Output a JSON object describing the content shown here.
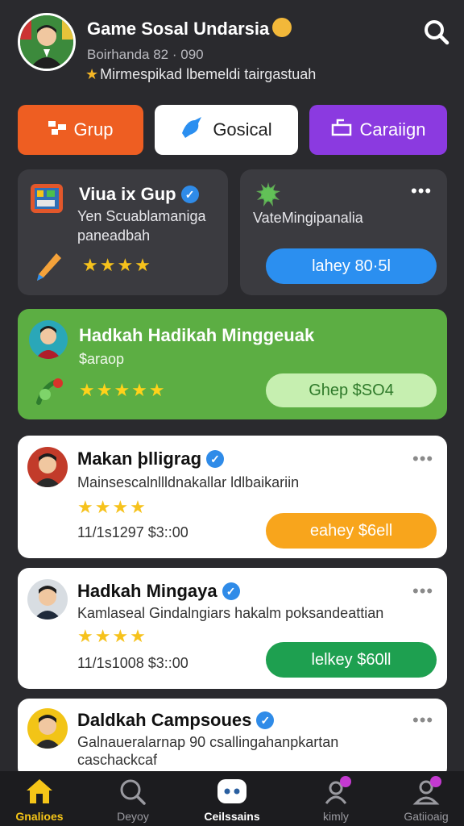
{
  "header": {
    "title": "Game Sosal Undarsia",
    "subtitle": "Boirhanda 82 · 090",
    "status": "Mirmespikad lbemeldi tairgastuah"
  },
  "tabs": [
    {
      "label": "Grup",
      "color": "#ee5e22"
    },
    {
      "label": "Gosical",
      "color": "#ffffff"
    },
    {
      "label": "Caraiign",
      "color": "#8b3ae0"
    }
  ],
  "card_group": {
    "title": "Viua ix Gup",
    "description_line1": "Yen Scuablamaniga",
    "description_line2": "paneadbah",
    "stars": "★★★★",
    "rating": 4
  },
  "card_activity": {
    "label": "VateMingipanalia",
    "button": "lahey 80·5l",
    "button_color": "#2b8ff0"
  },
  "card_featured": {
    "title": "Hadkah Hadikah Minggeuak",
    "subtitle": "$araop",
    "stars": "★★★★★",
    "rating": 5,
    "button": "Ghep $SO4"
  },
  "posts": [
    {
      "name": "Makan þlligrag",
      "text": "Mainsescalnllldnakallar ldlbaikariin",
      "stars": "★★★★",
      "rating": 4,
      "meta": "11/1s1297 $3::00",
      "button": "eahey $6ell",
      "button_color": "#f8a51c"
    },
    {
      "name": "Hadkah Mingaya",
      "text": "Kamlaseal Gindalngiars hakalm poksandeattian",
      "stars": "★★★★",
      "rating": 4,
      "meta": "11/1s1008 $3::00",
      "button": "lelkey $60ll",
      "button_color": "#1ea050"
    },
    {
      "name": "Daldkah Campsoues",
      "text_line1": "Galnaueralarnap 90 csallingahanpkartan",
      "text_line2": "caschackcaf"
    }
  ],
  "bottom_nav": [
    {
      "label": "Gnalioes",
      "icon": "home-icon",
      "active": true
    },
    {
      "label": "Deyoy",
      "icon": "search-icon"
    },
    {
      "label": "Ceilssains",
      "icon": "chat-bubble-icon"
    },
    {
      "label": "kimly",
      "icon": "profile-icon"
    },
    {
      "label": "Gatiioaig",
      "icon": "user-icon"
    }
  ]
}
